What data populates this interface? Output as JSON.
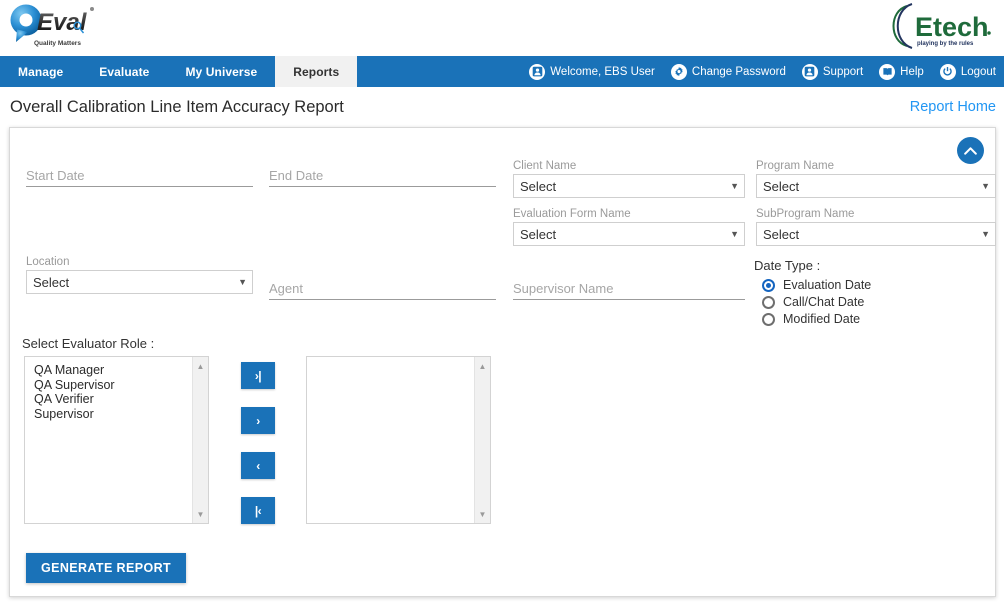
{
  "brand": {
    "qeval_name": "QEval",
    "qeval_tagline": "Quality Matters",
    "etech_name": "Etech",
    "etech_tagline": "playing by the rules"
  },
  "nav": {
    "tabs": [
      {
        "label": "Manage",
        "active": false
      },
      {
        "label": "Evaluate",
        "active": false
      },
      {
        "label": "My Universe",
        "active": false
      },
      {
        "label": "Reports",
        "active": true
      }
    ],
    "utilities": [
      {
        "label": "Welcome, EBS User",
        "icon": "user-icon"
      },
      {
        "label": "Change Password",
        "icon": "gear-icon"
      },
      {
        "label": "Support",
        "icon": "support-icon"
      },
      {
        "label": "Help",
        "icon": "book-icon"
      },
      {
        "label": "Logout",
        "icon": "power-icon"
      }
    ]
  },
  "page": {
    "title": "Overall Calibration Line Item Accuracy Report",
    "report_home_link": "Report Home"
  },
  "filters": {
    "start_date": {
      "label": "Start Date",
      "value": "",
      "placeholder": "Start Date"
    },
    "end_date": {
      "label": "End Date",
      "value": "",
      "placeholder": "End Date"
    },
    "client_name": {
      "label": "Client Name",
      "value": "Select"
    },
    "program_name": {
      "label": "Program Name",
      "value": "Select"
    },
    "evaluation_form_name": {
      "label": "Evaluation Form Name",
      "value": "Select"
    },
    "subprogram_name": {
      "label": "SubProgram Name",
      "value": "Select"
    },
    "location": {
      "label": "Location",
      "value": "Select"
    },
    "agent": {
      "label": "Agent",
      "value": "",
      "placeholder": "Agent"
    },
    "supervisor_name": {
      "label": "Supervisor Name",
      "value": "",
      "placeholder": "Supervisor Name"
    }
  },
  "date_type": {
    "title": "Date Type :",
    "options": [
      {
        "label": "Evaluation Date",
        "selected": true
      },
      {
        "label": "Call/Chat Date",
        "selected": false
      },
      {
        "label": "Modified Date",
        "selected": false
      }
    ]
  },
  "evaluator_role": {
    "title": "Select Evaluator Role :",
    "available": [
      "QA Manager",
      "QA Supervisor",
      "QA Verifier",
      "Supervisor"
    ],
    "selected": [],
    "buttons": [
      {
        "label": "›|",
        "name": "move-all-right-button"
      },
      {
        "label": "›",
        "name": "move-right-button"
      },
      {
        "label": "‹",
        "name": "move-left-button"
      },
      {
        "label": "|‹",
        "name": "move-all-left-button"
      }
    ]
  },
  "actions": {
    "generate_report": "GENERATE REPORT",
    "collapse": "collapse-panel"
  },
  "colors": {
    "nav_blue": "#1a72b8",
    "link_blue": "#2196f3",
    "radio_blue": "#1565c0",
    "etech_green": "#1f6b3b",
    "etech_navy": "#23355f"
  }
}
